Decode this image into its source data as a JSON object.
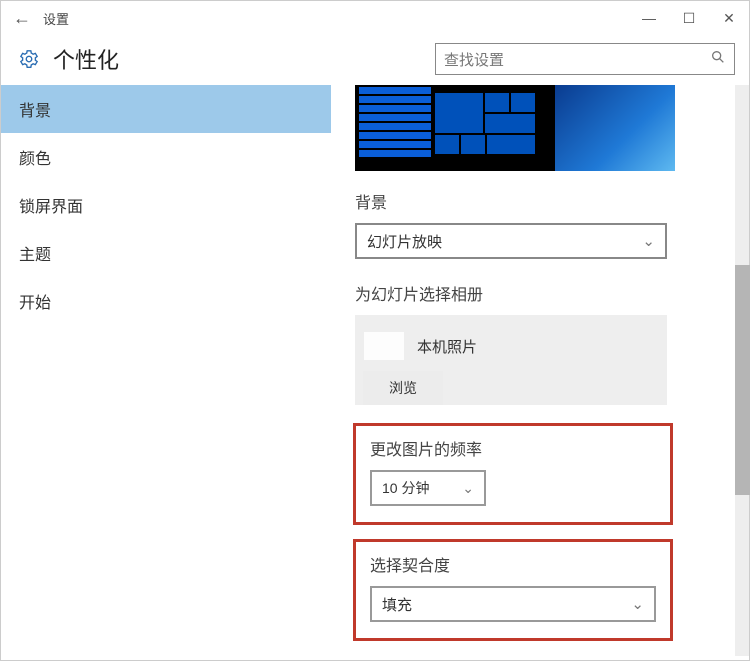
{
  "window": {
    "title": "设置",
    "controls": {
      "min": "—",
      "max": "☐",
      "close": "✕"
    }
  },
  "header": {
    "category": "个性化",
    "search_placeholder": "查找设置"
  },
  "sidebar": {
    "items": [
      {
        "label": "背景",
        "selected": true
      },
      {
        "label": "颜色"
      },
      {
        "label": "锁屏界面"
      },
      {
        "label": "主题"
      },
      {
        "label": "开始"
      }
    ]
  },
  "content": {
    "background_label": "背景",
    "background_value": "幻灯片放映",
    "album_label": "为幻灯片选择相册",
    "album_name": "本机照片",
    "browse_label": "浏览",
    "freq_label": "更改图片的频率",
    "freq_value": "10 分钟",
    "fit_label": "选择契合度",
    "fit_value": "填充"
  },
  "icons": {
    "back": "←",
    "chevron": "⌄",
    "search": "🔍"
  }
}
